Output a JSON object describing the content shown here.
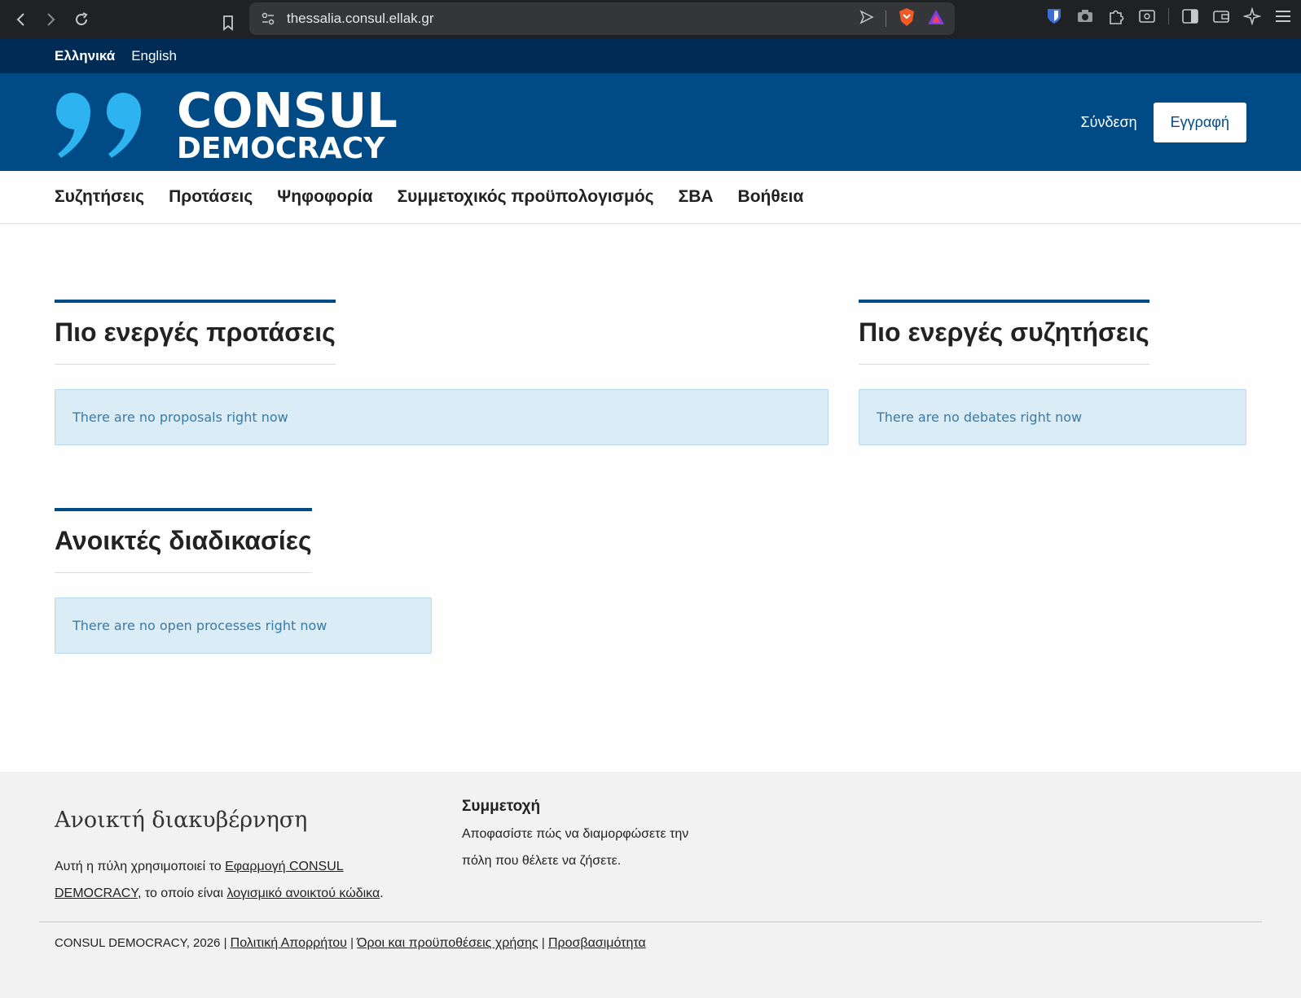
{
  "browser": {
    "url": "thessalia.consul.ellak.gr"
  },
  "languages": [
    {
      "label": "Ελληνικά",
      "active": true
    },
    {
      "label": "English",
      "active": false
    }
  ],
  "header": {
    "logo_line1": "CONSUL",
    "logo_line2": "DEMOCRACY",
    "signin": "Σύνδεση",
    "register": "Εγγραφή"
  },
  "nav": {
    "items": [
      "Συζητήσεις",
      "Προτάσεις",
      "Ψηφοφορία",
      "Συμμετοχικός προϋπολογισμός",
      "ΣΒΑ",
      "Βοήθεια"
    ]
  },
  "sections": {
    "proposals": {
      "title": "Πιο ενεργές προτάσεις",
      "empty": "There are no proposals right now"
    },
    "debates": {
      "title": "Πιο ενεργές συζητήσεις",
      "empty": "There are no debates right now"
    },
    "processes": {
      "title": "Ανοικτές διαδικασίες",
      "empty": "There are no open processes right now"
    }
  },
  "footer": {
    "brand": "Ανοικτή διακυβέρνηση",
    "about_prefix": "Αυτή η πύλη χρησιμοποιεί το ",
    "about_link1": "Εφαρμογή CONSUL DEMOCRACY",
    "about_mid": ", το οποίο είναι ",
    "about_link2": "λογισμικό ανοικτού κώδικα",
    "about_suffix": ".",
    "participation_title": "Συμμετοχή",
    "participation_text": "Αποφασίστε πώς να διαμορφώσετε την πόλη που θέλετε να ζήσετε.",
    "copyright": "CONSUL DEMOCRACY, 2026 | ",
    "privacy": "Πολιτική Απορρήτου",
    "sep1": " | ",
    "terms": "Όροι και προϋποθέσεις χρήσης",
    "sep2": " | ",
    "accessibility": "Προσβασιμότητα"
  },
  "colors": {
    "top_bar": "#002b54",
    "header": "#004a86",
    "accent": "#004a86",
    "callout_bg": "#daecf6",
    "callout_text": "#3b7aa6",
    "footer_bg": "#f2f2f2"
  }
}
